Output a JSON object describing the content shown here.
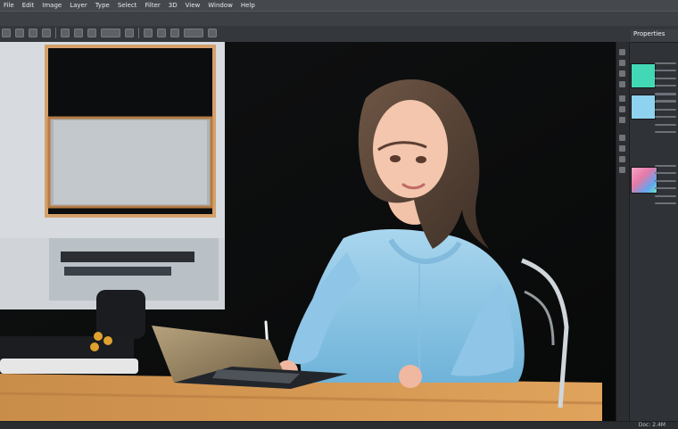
{
  "menubar": {
    "items": [
      "File",
      "Edit",
      "Image",
      "Layer",
      "Type",
      "Select",
      "Filter",
      "3D",
      "View",
      "Window",
      "Help"
    ]
  },
  "toolbar": {
    "tools": [
      "move-tool",
      "select-tool",
      "lasso-tool",
      "crop-tool",
      "eyedropper-tool",
      "brush-tool",
      "eraser-tool",
      "clone-tool",
      "gradient-tool",
      "pen-tool",
      "type-tool",
      "shape-tool",
      "hand-tool",
      "zoom-tool"
    ]
  },
  "right_panel": {
    "tab_title": "Properties",
    "swatches": [
      {
        "name": "swatch-teal",
        "color": "#42d8b6"
      },
      {
        "name": "swatch-light-blue",
        "color": "#8fd2f0"
      },
      {
        "name": "swatch-gradient",
        "color": "#e57aa7"
      }
    ]
  },
  "status": {
    "text": "Doc: 2.4M"
  },
  "colors": {
    "ui_bg": "#3a3c3f",
    "panel_bg": "#2f3236",
    "canvas_bg": "#0f1012"
  }
}
